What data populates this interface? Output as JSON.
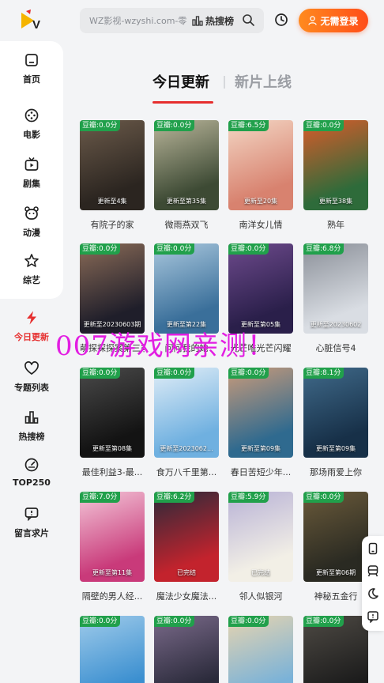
{
  "header": {
    "search_placeholder": "WZ影视-wzyshi.com-零",
    "hot_label": "热搜榜",
    "login_label": "无需登录"
  },
  "sidebar": {
    "items": [
      {
        "label": "首页",
        "icon": "home-icon"
      },
      {
        "label": "电影",
        "icon": "film-reel-icon"
      },
      {
        "label": "剧集",
        "icon": "tv-icon"
      },
      {
        "label": "动漫",
        "icon": "bear-icon"
      },
      {
        "label": "综艺",
        "icon": "star-icon"
      },
      {
        "label": "今日更新",
        "icon": "lightning-icon",
        "active": true
      },
      {
        "label": "专题列表",
        "icon": "heart-icon"
      },
      {
        "label": "热搜榜",
        "icon": "bar-chart-icon"
      },
      {
        "label": "TOP250",
        "icon": "gauge-icon"
      },
      {
        "label": "留言求片",
        "icon": "message-icon"
      }
    ]
  },
  "tabs": {
    "today": "今日更新",
    "new": "新片上线"
  },
  "cards": [
    {
      "score": "豆瓣:0.0分",
      "status": "更新至4集",
      "title": "有院子的家",
      "color1": "#2b2520",
      "color2": "#6b5a4a"
    },
    {
      "score": "豆瓣:0.0分",
      "status": "更新至第35集",
      "title": "微雨燕双飞",
      "color1": "#3d4a34",
      "color2": "#b9b59a"
    },
    {
      "score": "豆瓣:6.5分",
      "status": "更新至20集",
      "title": "南洋女儿情",
      "color1": "#d8826f",
      "color2": "#f3d6c4"
    },
    {
      "score": "豆瓣:0.0分",
      "status": "更新至38集",
      "title": "熟年",
      "color1": "#2e6b3a",
      "color2": "#d95b2a"
    },
    {
      "score": "豆瓣:0.0分",
      "status": "更新至20230603期",
      "title": "萌探探探案第三季",
      "color1": "#1f1e2a",
      "color2": "#8a6b57"
    },
    {
      "score": "豆瓣:0.0分",
      "status": "更新至第22集",
      "title": "问问我的她",
      "color1": "#3a6f9a",
      "color2": "#a9c7dd"
    },
    {
      "score": "豆瓣:0.0分",
      "status": "更新至第05集",
      "title": "光芒唯光芒闪耀",
      "color1": "#2a1f4a",
      "color2": "#6d4a8c"
    },
    {
      "score": "豆瓣:6.8分",
      "status": "更新至20230602",
      "title": "心脏信号4",
      "color1": "#d9dde3",
      "color2": "#8a8f98"
    },
    {
      "score": "豆瓣:0.0分",
      "status": "更新至第08集",
      "title": "最佳利益3-最...",
      "color1": "#131313",
      "color2": "#4a4a4a"
    },
    {
      "score": "豆瓣:0.0分",
      "status": "更新至2023062...",
      "title": "食万八千里第...",
      "color1": "#6fb0e0",
      "color2": "#e0edf7"
    },
    {
      "score": "豆瓣:0.0分",
      "status": "更新至第09集",
      "title": "春日苦短少年...",
      "color1": "#2f6a8f",
      "color2": "#c89a7a"
    },
    {
      "score": "豆瓣:8.1分",
      "status": "更新至第09集",
      "title": "那场雨爱上你",
      "color1": "#173048",
      "color2": "#406a8a"
    },
    {
      "score": "豆瓣:7.0分",
      "status": "更新至第11集",
      "title": "隔壁的男人经...",
      "color1": "#c93a7a",
      "color2": "#f3c6d8"
    },
    {
      "score": "豆瓣:6.2分",
      "status": "已完结",
      "title": "魔法少女魔法...",
      "color1": "#c3232d",
      "color2": "#2a2a3a"
    },
    {
      "score": "豆瓣:5.9分",
      "status": "已完结",
      "title": "邻人似银河",
      "color1": "#f2efe6",
      "color2": "#b8b2d6"
    },
    {
      "score": "豆瓣:0.0分",
      "status": "更新至第06期",
      "title": "神秘五金行",
      "color1": "#2a2a22",
      "color2": "#6a5a3a"
    },
    {
      "score": "豆瓣:0.0分",
      "status": "",
      "title": "",
      "color1": "#3b8fd0",
      "color2": "#9fcbea"
    },
    {
      "score": "豆瓣:0.0分",
      "status": "",
      "title": "",
      "color1": "#2a2a3a",
      "color2": "#7a6a8a"
    },
    {
      "score": "豆瓣:0.0分",
      "status": "",
      "title": "",
      "color1": "#7ab2d8",
      "color2": "#e6d4b0"
    },
    {
      "score": "豆瓣:0.0分",
      "status": "",
      "title": "",
      "color1": "#1c1c1c",
      "color2": "#4e4a44"
    }
  ],
  "watermark": "007游戏网亲测！",
  "colors": {
    "accent": "#e62e2e",
    "login_gradient_start": "#ff8a1e",
    "login_gradient_end": "#ff4d1a",
    "score_badge": "#21a04b",
    "watermark": "#e21ee2"
  }
}
